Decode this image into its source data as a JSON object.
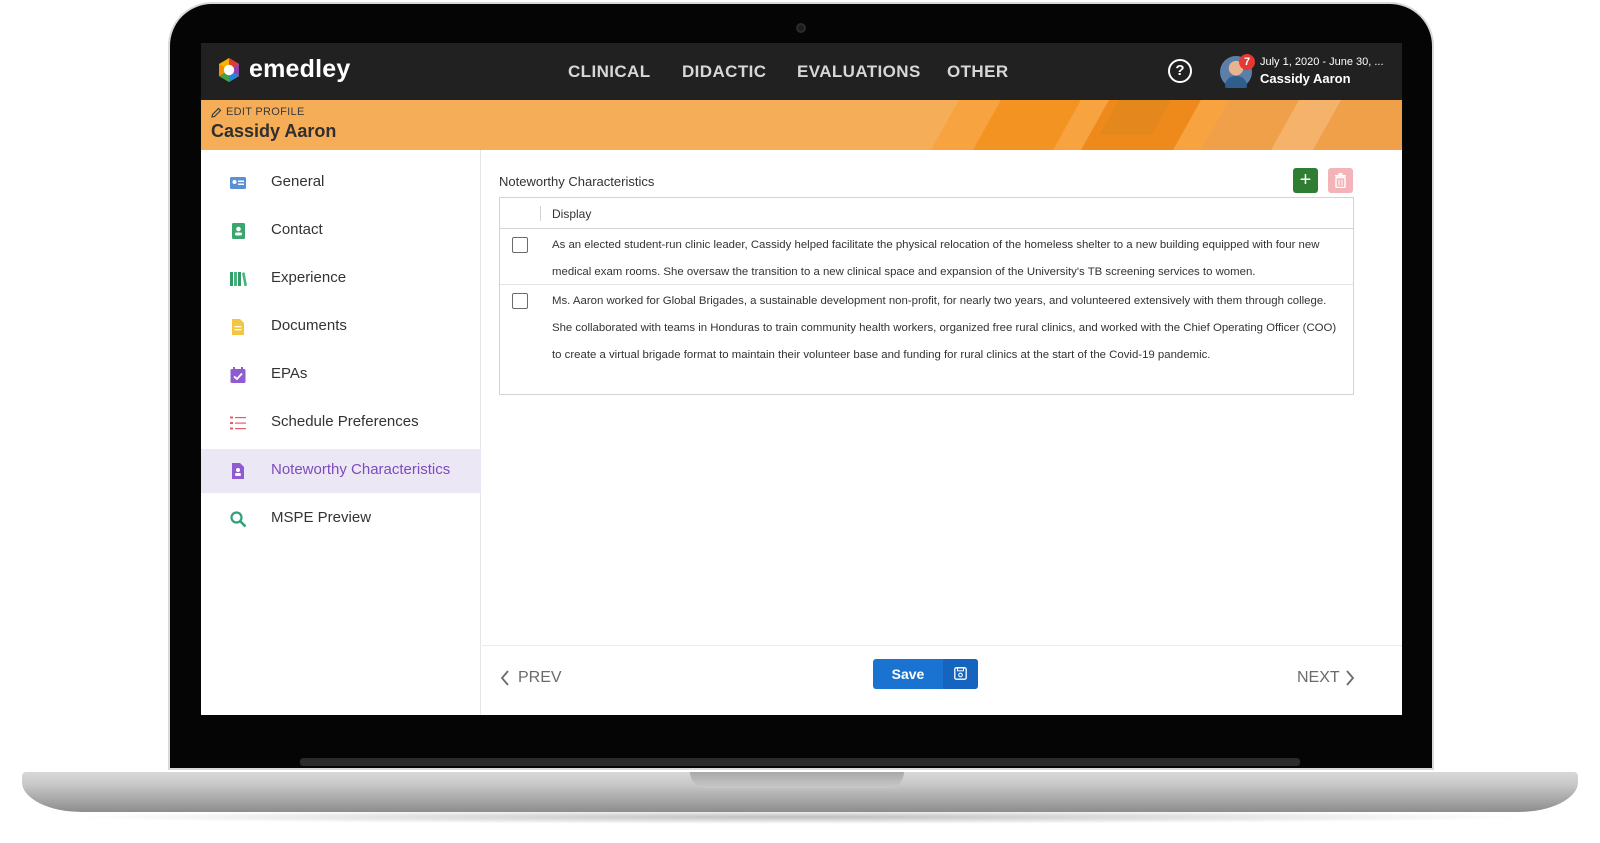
{
  "app": {
    "brand": "emedley",
    "nav": [
      "CLINICAL",
      "DIDACTIC",
      "EVALUATIONS",
      "OTHER"
    ],
    "help_glyph": "?",
    "user": {
      "notification_count": "7",
      "dates": "July 1, 2020 - June 30, ...",
      "name": "Cassidy Aaron"
    }
  },
  "banner": {
    "edit_label": "EDIT PROFILE",
    "name": "Cassidy Aaron"
  },
  "sidebar": {
    "items": [
      {
        "label": "General",
        "icon": "id-card-icon"
      },
      {
        "label": "Contact",
        "icon": "contact-book-icon"
      },
      {
        "label": "Experience",
        "icon": "books-icon"
      },
      {
        "label": "Documents",
        "icon": "document-icon"
      },
      {
        "label": "EPAs",
        "icon": "calendar-check-icon"
      },
      {
        "label": "Schedule Preferences",
        "icon": "list-icon"
      },
      {
        "label": "Noteworthy Characteristics",
        "icon": "person-document-icon",
        "active": true
      },
      {
        "label": "MSPE Preview",
        "icon": "search-icon"
      }
    ]
  },
  "main": {
    "section_title": "Noteworthy Characteristics",
    "add_label": "+",
    "column_header": "Display",
    "rows": [
      "As an elected student-run clinic leader, Cassidy helped facilitate the physical relocation of the homeless shelter to a new building equipped with four new medical exam rooms. She oversaw the transition to a new clinical space and expansion of the University's TB screening services to women.",
      "Ms. Aaron worked for Global Brigades, a sustainable development non-profit, for nearly two years, and volunteered extensively with them through college. She collaborated with teams in Honduras to train community health workers, organized free rural clinics, and worked with the Chief Operating Officer (COO) to create a virtual brigade format to maintain their volunteer base and funding for rural clinics at the start of the Covid-19 pandemic."
    ]
  },
  "footer": {
    "prev": "PREV",
    "next": "NEXT",
    "save": "Save"
  },
  "colors": {
    "topbar": "#212121",
    "banner": "#f6ad58",
    "active": "#7d4bbd",
    "add": "#2e7d32",
    "delete": "#f4b3b8",
    "save": "#1a73d1"
  }
}
